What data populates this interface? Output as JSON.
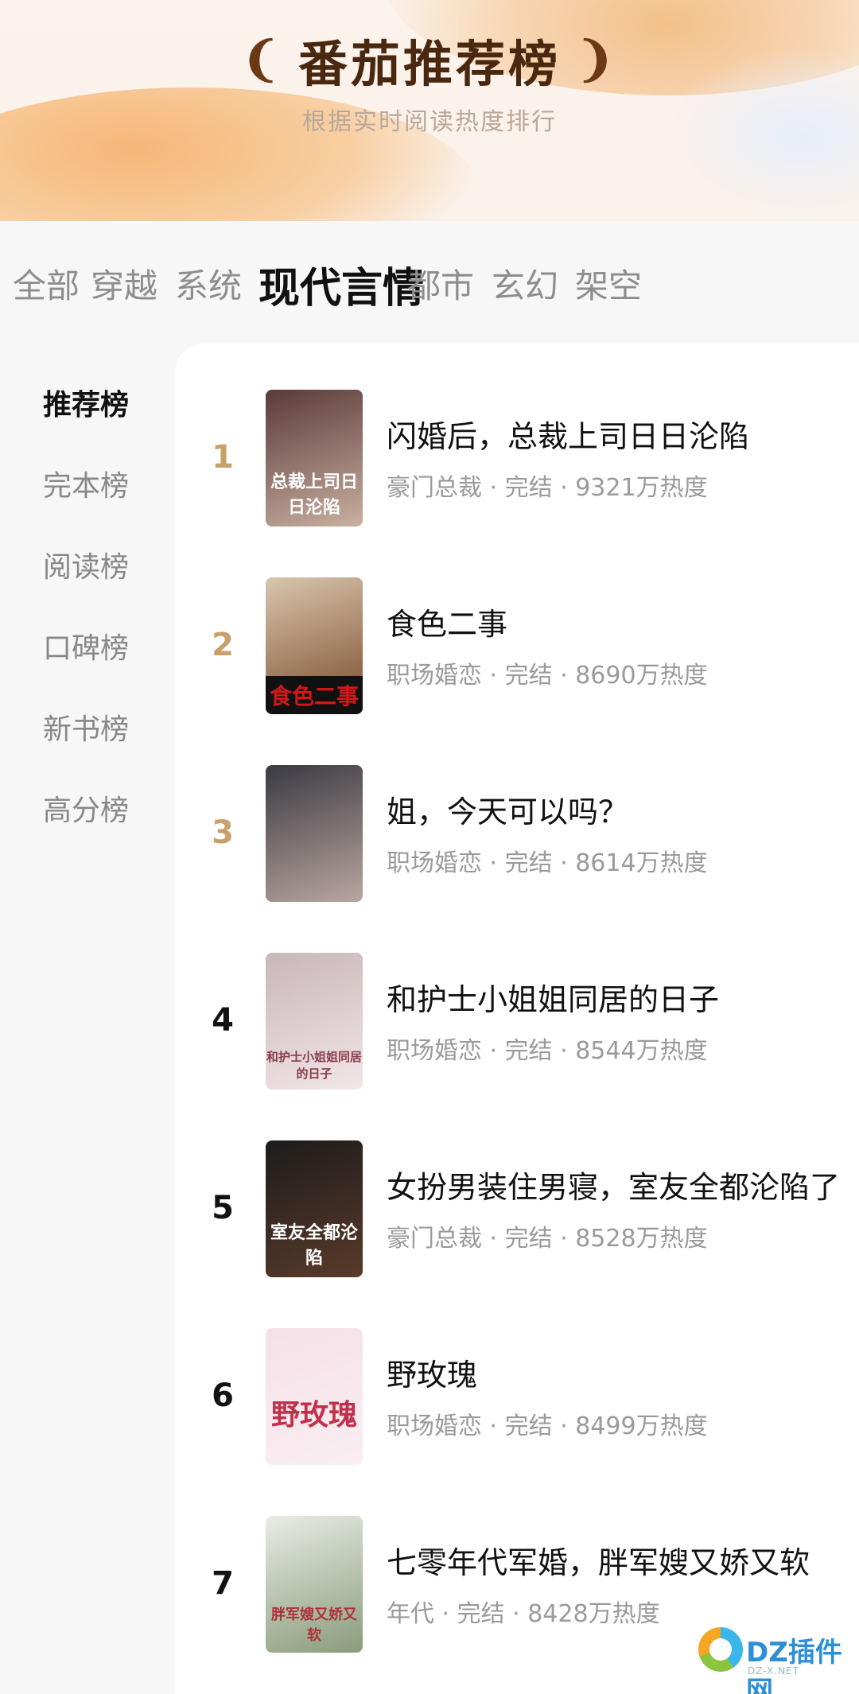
{
  "header": {
    "title": "番茄推荐榜",
    "subtitle": "根据实时阅读热度排行"
  },
  "tabs": [
    {
      "label": "全部",
      "active": false
    },
    {
      "label": "穿越",
      "active": false
    },
    {
      "label": "系统",
      "active": false
    },
    {
      "label": "现代言情",
      "active": true
    },
    {
      "label": "都市",
      "active": false
    },
    {
      "label": "玄幻",
      "active": false
    },
    {
      "label": "架空",
      "active": false
    }
  ],
  "sidebar": {
    "items": [
      {
        "label": "推荐榜",
        "active": true
      },
      {
        "label": "完本榜",
        "active": false
      },
      {
        "label": "阅读榜",
        "active": false
      },
      {
        "label": "口碑榜",
        "active": false
      },
      {
        "label": "新书榜",
        "active": false
      },
      {
        "label": "高分榜",
        "active": false
      }
    ]
  },
  "books": [
    {
      "rank": "1",
      "title": "闪婚后，总裁上司日日沦陷",
      "meta": "豪门总裁 · 完结 · 9321万热度",
      "cover_text": "总裁上司日日沦陷",
      "cover_colors": [
        "#5a3a3a",
        "#c9b0a0"
      ]
    },
    {
      "rank": "2",
      "title": "食色二事",
      "meta": "职场婚恋 · 完结 · 8690万热度",
      "cover_text": "食色二事",
      "cover_colors": [
        "#d8c6ae",
        "#7a4a2a"
      ]
    },
    {
      "rank": "3",
      "title": "姐，今天可以吗？",
      "meta": "职场婚恋 · 完结 · 8614万热度",
      "cover_text": "",
      "cover_colors": [
        "#3a3a42",
        "#b9a6a0"
      ]
    },
    {
      "rank": "4",
      "title": "和护士小姐姐同居的日子",
      "meta": "职场婚恋 · 完结 · 8544万热度",
      "cover_text": "和护士小姐姐同居的日子",
      "cover_colors": [
        "#c9b6b8",
        "#f2e6e8"
      ]
    },
    {
      "rank": "5",
      "title": "女扮男装住男寝，室友全都沦陷了",
      "meta": "豪门总裁 · 完结 · 8528万热度",
      "cover_text": "室友全都沦陷",
      "cover_colors": [
        "#1c1c1c",
        "#5a3a2a"
      ]
    },
    {
      "rank": "6",
      "title": "野玫瑰",
      "meta": "职场婚恋 · 完结 · 8499万热度",
      "cover_text": "野玫瑰",
      "cover_colors": [
        "#f6e0e8",
        "#f9eef2"
      ]
    },
    {
      "rank": "7",
      "title": "七零年代军婚，胖军嫂又娇又软",
      "meta": "年代 · 完结 · 8428万热度",
      "cover_text": "胖军嫂又娇又软",
      "cover_colors": [
        "#e9ece6",
        "#8a9c7a"
      ]
    }
  ],
  "watermark": {
    "text": "DZ插件网",
    "sub": "DZ-X.NET"
  }
}
